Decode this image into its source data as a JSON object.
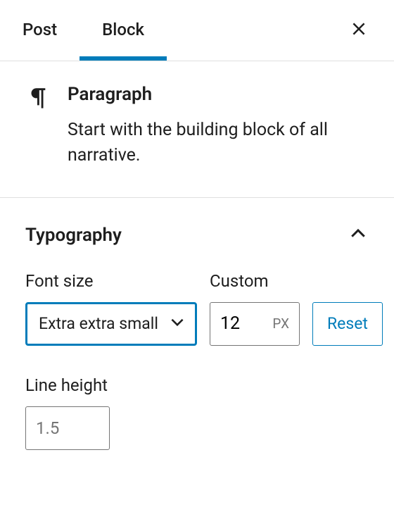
{
  "tabs": {
    "post": "Post",
    "block": "Block"
  },
  "block": {
    "name": "Paragraph",
    "description": "Start with the building block of all narrative."
  },
  "typography": {
    "panel_title": "Typography",
    "font_size_label": "Font size",
    "font_size_selected": "Extra extra small",
    "custom_label": "Custom",
    "custom_value": "12",
    "custom_unit": "PX",
    "reset_label": "Reset",
    "line_height_label": "Line height",
    "line_height_placeholder": "1.5"
  }
}
